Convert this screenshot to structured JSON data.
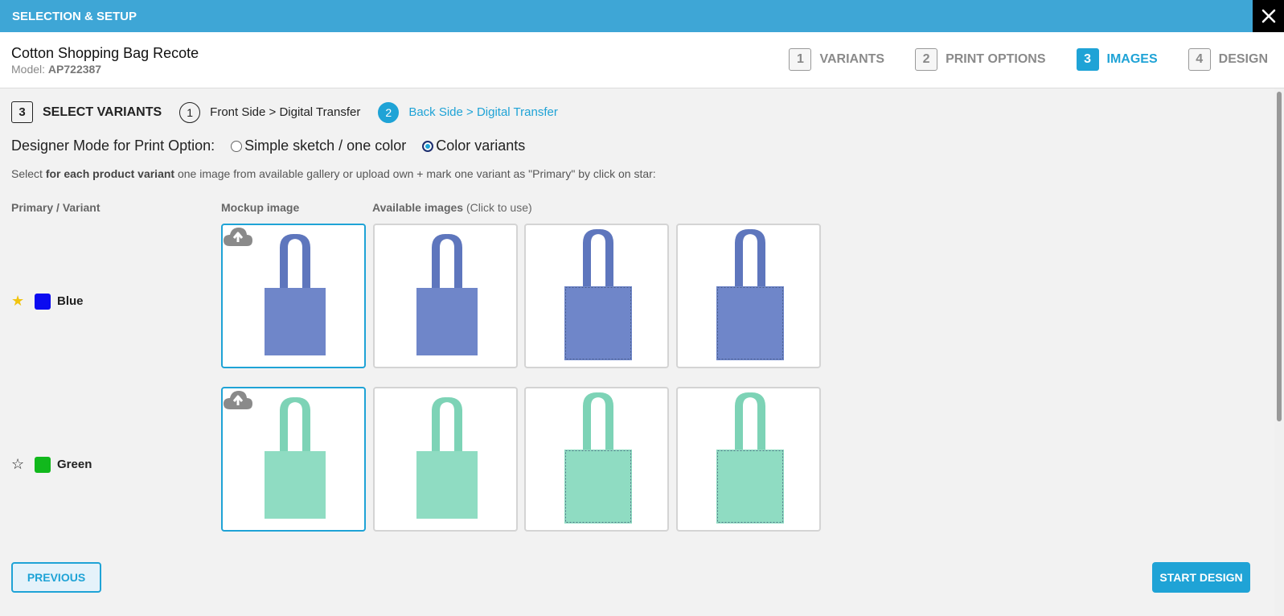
{
  "topbar": {
    "title": "SELECTION & SETUP"
  },
  "product": {
    "name": "Cotton Shopping Bag Recote",
    "model_label": "Model:",
    "model_value": "AP722387"
  },
  "wizard": {
    "steps": [
      {
        "num": "1",
        "label": "VARIANTS"
      },
      {
        "num": "2",
        "label": "PRINT OPTIONS"
      },
      {
        "num": "3",
        "label": "IMAGES"
      },
      {
        "num": "4",
        "label": "DESIGN"
      }
    ]
  },
  "substep": {
    "num": "3",
    "title": "SELECT VARIANTS",
    "steps": [
      {
        "num": "1",
        "label": "Front Side > Digital Transfer"
      },
      {
        "num": "2",
        "label": "Back Side > Digital Transfer"
      }
    ]
  },
  "mode": {
    "label": "Designer Mode for Print Option:",
    "options": [
      "Simple sketch / one color",
      "Color variants"
    ],
    "selected": "Color variants"
  },
  "instruction": {
    "pre": "Select ",
    "bold": "for each product variant",
    "post": " one image from available gallery or upload own + mark one variant as \"Primary\" by click on star:"
  },
  "columns": {
    "primary_variant": "Primary / Variant",
    "mockup": "Mockup image",
    "available": "Available images",
    "available_note": "(Click to use)"
  },
  "variants": [
    {
      "name": "Blue",
      "swatch": "#0b0bf0",
      "bag_color": "#6f86c9",
      "handle_color": "#5e76bd",
      "primary": true
    },
    {
      "name": "Green",
      "swatch": "#11b81c",
      "bag_color": "#8fdcc2",
      "handle_color": "#7dd3b6",
      "primary": false
    }
  ],
  "buttons": {
    "previous": "PREVIOUS",
    "start_design": "START DESIGN"
  },
  "colors": {
    "accent": "#1fa3d6",
    "topbar": "#3ea6d6"
  },
  "icons": {
    "close": "close-icon",
    "upload": "upload-cloud-icon",
    "star": "star-icon"
  }
}
